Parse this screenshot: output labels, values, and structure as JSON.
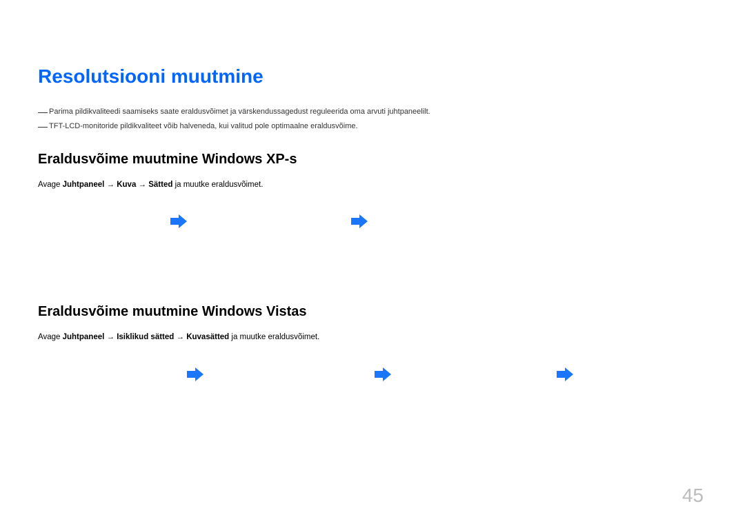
{
  "main_title": "Resolutsiooni muutmine",
  "notes": [
    "Parima pildikvaliteedi saamiseks saate eraldusvõimet ja värskendussagedust reguleerida oma arvuti juhtpaneelilt.",
    "TFT-LCD-monitoride pildikvaliteet võib halveneda, kui valitud pole optimaalne eraldusvõime."
  ],
  "section_xp": {
    "title": "Eraldusvõime muutmine Windows XP-s",
    "instruction_prefix": "Avage ",
    "path1": "Juhtpaneel",
    "arrow1": " → ",
    "path2": "Kuva",
    "arrow2": " → ",
    "path3": "Sätted",
    "instruction_suffix": " ja muutke eraldusvõimet."
  },
  "section_vista": {
    "title": "Eraldusvõime muutmine Windows Vistas",
    "instruction_prefix": "Avage ",
    "path1": "Juhtpaneel",
    "arrow1": " → ",
    "path2": "Isiklikud sätted",
    "arrow2": " → ",
    "path3": "Kuvasätted",
    "instruction_suffix": " ja muutke eraldusvõimet."
  },
  "page_number": "45"
}
